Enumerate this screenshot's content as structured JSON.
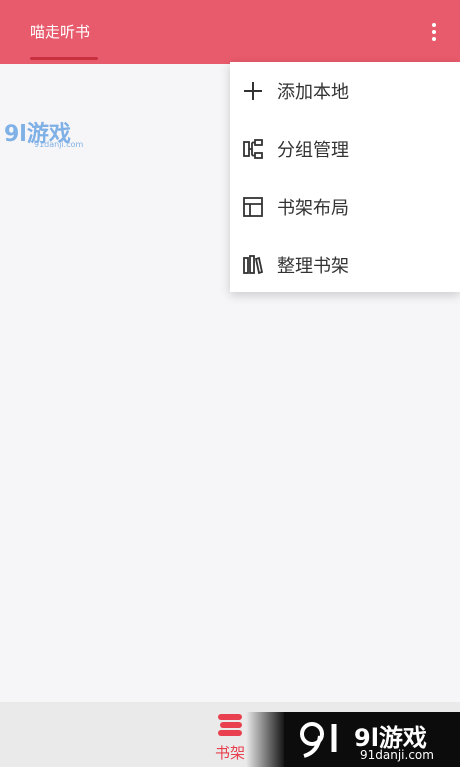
{
  "appbar": {
    "title": "喵走听书",
    "color": "#e85b6c"
  },
  "menu": {
    "items": [
      {
        "label": "添加本地",
        "icon": "plus-icon"
      },
      {
        "label": "分组管理",
        "icon": "group-tree-icon"
      },
      {
        "label": "书架布局",
        "icon": "layout-icon"
      },
      {
        "label": "整理书架",
        "icon": "books-icon"
      }
    ]
  },
  "bottom_nav": {
    "shelf_label": "书架",
    "accent": "#e8404f"
  },
  "watermark": {
    "main": "9l游戏",
    "sub": "91danji.com"
  },
  "badge": {
    "main": "9l游戏",
    "sub": "91danji.com"
  }
}
